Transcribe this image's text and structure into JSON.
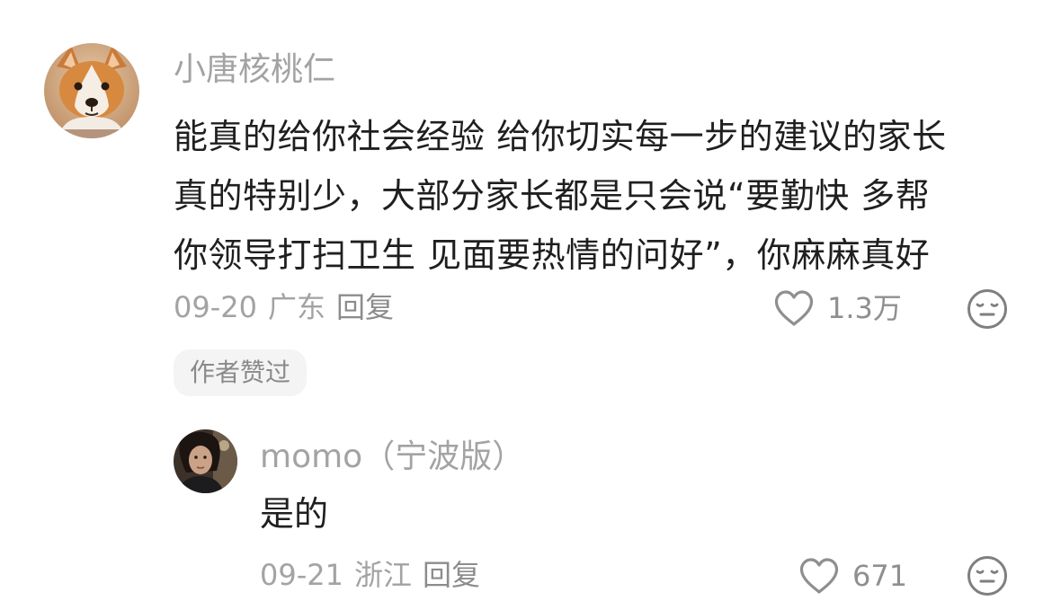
{
  "comment": {
    "username": "小唐核桃仁",
    "text_lines": [
      "能真的给你社会经验 给你切实每一步的建议的家长",
      "真的特别少，大部分家长都是只会说“要勤快 多帮",
      "你领导打扫卫生 见面要热情的问好”，你麻麻真好"
    ],
    "date": "09-20",
    "region": "广东",
    "reply_label": "回复",
    "like_count": "1.3万",
    "author_badge": "作者赞过"
  },
  "reply": {
    "username": "momo（宁波版）",
    "text": "是的",
    "date": "09-21",
    "region": "浙江",
    "reply_label": "回复",
    "like_count": "671"
  },
  "colors": {
    "meta_gray": "#a3a3a3",
    "text": "#1f1f1f",
    "badge_bg": "#f4f4f4"
  },
  "icons": [
    "heart-outline-icon",
    "dislike-face-icon"
  ]
}
